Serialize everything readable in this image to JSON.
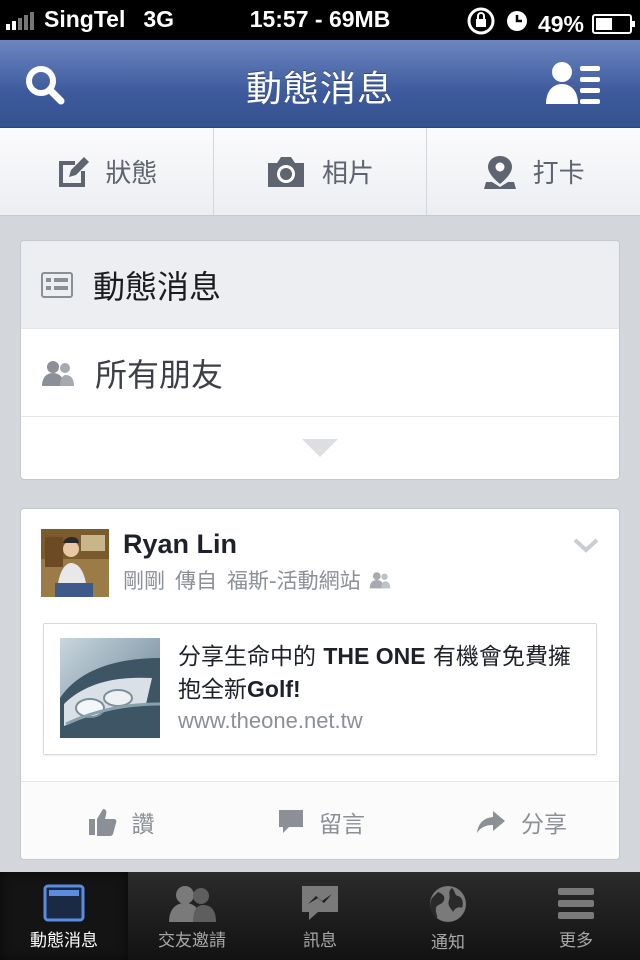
{
  "status_bar": {
    "carrier": "SingTel",
    "network": "3G",
    "time_and_data": "15:57 - 69MB",
    "battery": "49%",
    "battery_level": 0.49,
    "signal_bars": 2
  },
  "nav_bar": {
    "title": "動態消息",
    "search_icon": "search-icon",
    "friends_icon": "friends-list-icon"
  },
  "composer": {
    "status": "狀態",
    "photo": "相片",
    "checkin": "打卡"
  },
  "feed_filter": {
    "current": "動態消息",
    "option": "所有朋友"
  },
  "post": {
    "author": "Ryan Lin",
    "time": "剛剛",
    "via": "傳自",
    "source": "福斯-活動網站",
    "link": {
      "title_part1": "分享生命中的 ",
      "title_bold1": "THE ONE",
      "title_part2": " 有機會免費擁抱全新",
      "title_bold2": "Golf!",
      "url": "www.theone.net.tw"
    },
    "actions": {
      "like": "讚",
      "comment": "留言",
      "share": "分享"
    }
  },
  "tab_bar": {
    "tabs": [
      {
        "label": "動態消息",
        "icon": "news-feed-icon",
        "active": true
      },
      {
        "label": "交友邀請",
        "icon": "friend-requests-icon",
        "active": false
      },
      {
        "label": "訊息",
        "icon": "messages-icon",
        "active": false
      },
      {
        "label": "通知",
        "icon": "notifications-globe-icon",
        "active": false
      },
      {
        "label": "更多",
        "icon": "more-menu-icon",
        "active": false
      }
    ]
  },
  "colors": {
    "nav_blue": "#3d5a9c",
    "text_dark": "#1d2129",
    "text_gray": "#8b8f96",
    "background": "#d3d6db"
  }
}
